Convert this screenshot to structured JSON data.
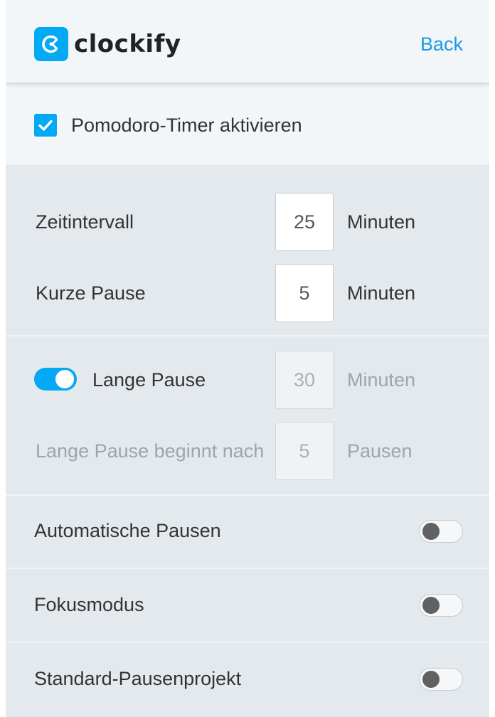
{
  "header": {
    "brand": "clockify",
    "back_label": "Back",
    "accent_color": "#03a9f4",
    "link_color": "#1a9ae6"
  },
  "pomodoro": {
    "enable_label": "Pomodoro-Timer aktivieren",
    "enabled": true
  },
  "intervals": {
    "work": {
      "label": "Zeitintervall",
      "value": "25",
      "unit": "Minuten"
    },
    "short_break": {
      "label": "Kurze Pause",
      "value": "5",
      "unit": "Minuten"
    }
  },
  "long_break": {
    "label": "Lange Pause",
    "enabled": true,
    "value": "30",
    "unit": "Minuten",
    "after_label": "Lange Pause beginnt nach",
    "after_value": "5",
    "after_unit": "Pausen"
  },
  "toggles": [
    {
      "label": "Automatische Pausen",
      "enabled": false
    },
    {
      "label": "Fokusmodus",
      "enabled": false
    },
    {
      "label": "Standard-Pausenprojekt",
      "enabled": false
    }
  ]
}
